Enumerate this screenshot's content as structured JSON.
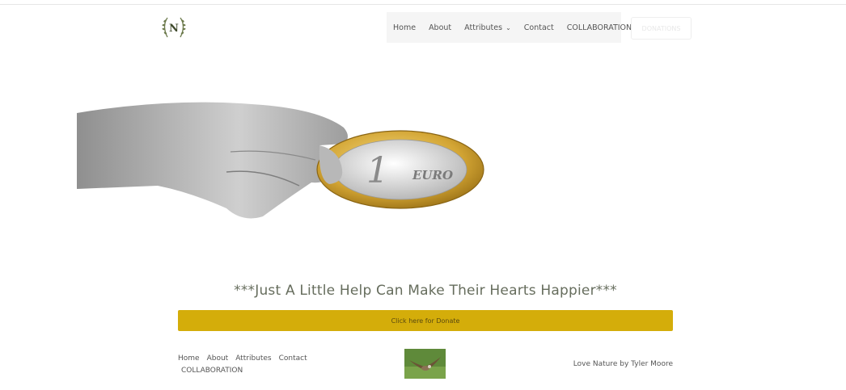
{
  "header": {
    "logo_letter": "N",
    "nav": [
      {
        "label": "Home"
      },
      {
        "label": "About"
      },
      {
        "label": "Attributes",
        "has_dropdown": true
      },
      {
        "label": "Contact"
      },
      {
        "label": "COLLABORATION"
      }
    ],
    "donations_label": "DONATIONS"
  },
  "hero": {
    "coin_numeral": "1",
    "coin_text": "EURO"
  },
  "main": {
    "tagline": "***Just A Little Help Can Make Their Hearts Happier***",
    "donate_button": "Click here for Donate",
    "button_color": "#d4ad0a"
  },
  "footer": {
    "nav": [
      "Home",
      "About",
      "Attributes",
      "Contact",
      "COLLABORATION"
    ],
    "credit": "Love Nature by Tyler Moore"
  }
}
